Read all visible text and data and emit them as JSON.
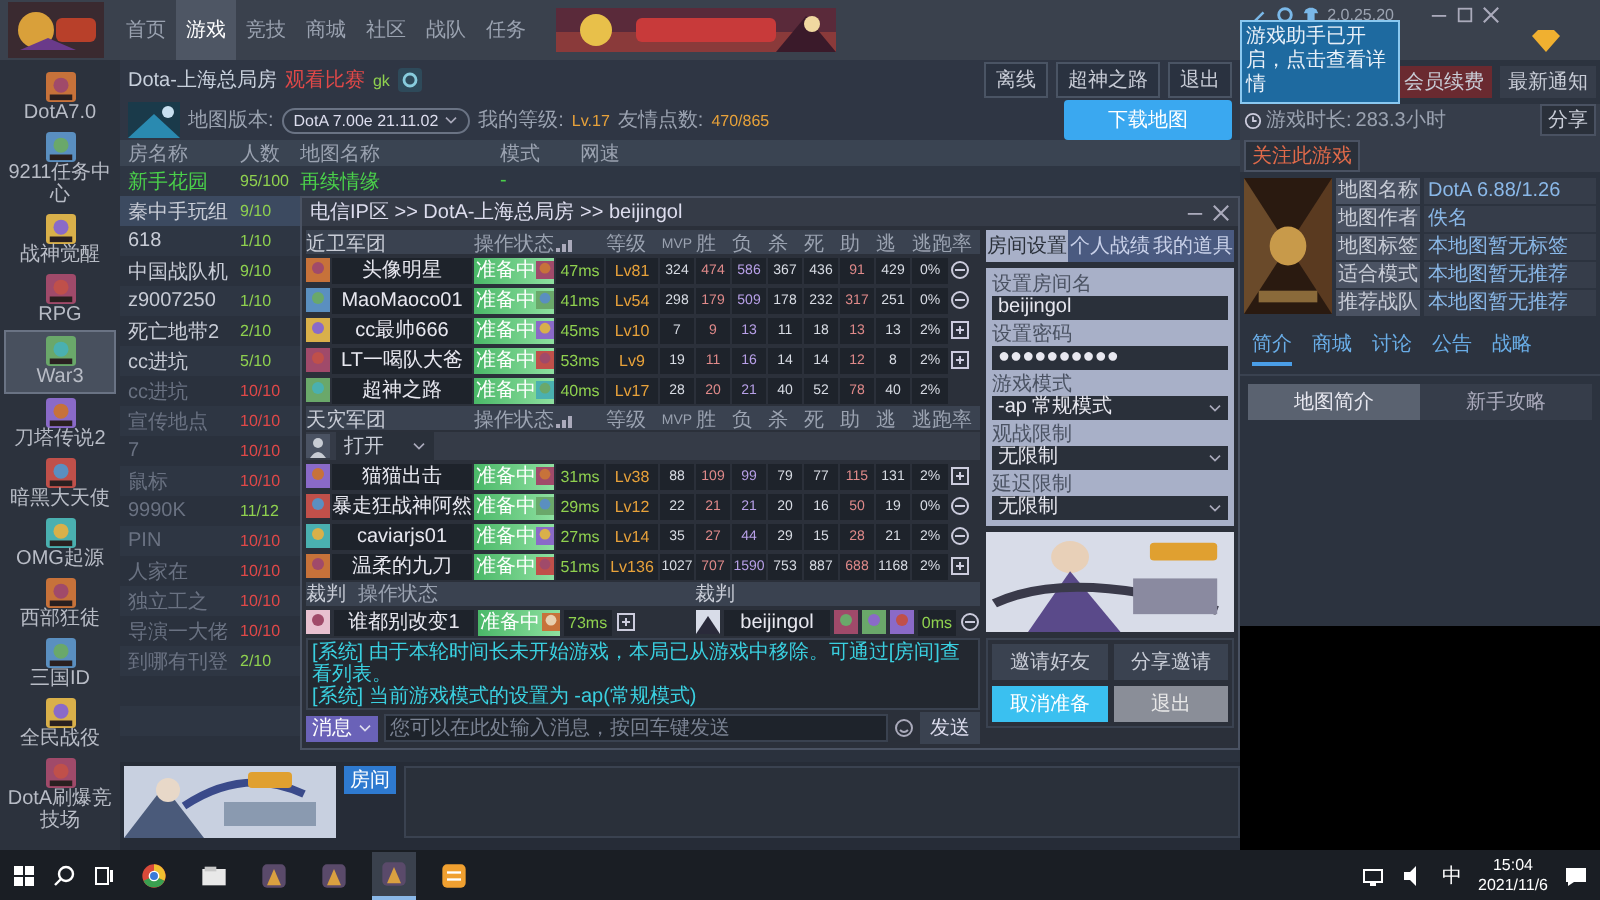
{
  "app_bar": {
    "tabs": [
      {
        "label": "首页",
        "selected": false
      },
      {
        "label": "游戏",
        "selected": true
      },
      {
        "label": "竞技",
        "selected": false
      },
      {
        "label": "商城",
        "selected": false
      },
      {
        "label": "社区",
        "selected": false
      },
      {
        "label": "战队",
        "selected": false
      },
      {
        "label": "任务",
        "selected": false
      }
    ],
    "version": "2.0.25.20"
  },
  "notice_popup": {
    "text": "游戏助手已开启，点击查看详情"
  },
  "sidebar": {
    "items": [
      {
        "label": "DotA7.0",
        "selected": false
      },
      {
        "label": "9211任务中心",
        "selected": false
      },
      {
        "label": "战神觉醒",
        "selected": false
      },
      {
        "label": "RPG",
        "selected": false
      },
      {
        "label": "War3",
        "selected": true
      },
      {
        "label": "刀塔传说2",
        "selected": false
      },
      {
        "label": "暗黑大天使",
        "selected": false
      },
      {
        "label": "OMG起源",
        "selected": false
      },
      {
        "label": "西部狂徒",
        "selected": false
      },
      {
        "label": "三国ID",
        "selected": false
      },
      {
        "label": "全民战役",
        "selected": false
      },
      {
        "label": "DotA刷爆竞技场",
        "selected": false
      }
    ]
  },
  "room": {
    "title": "Dota-上海总局房",
    "tag": "观看比赛",
    "code": "gk",
    "map_version_label": "地图版本:",
    "map_version": "DotA 7.00e 21.11.02",
    "level_label": "我的等级:",
    "level": "Lv.17",
    "friend_label": "友情点数:",
    "friend_points": "470/865",
    "actions": [
      "离线",
      "超神之路",
      "退出"
    ],
    "download": "下载地图"
  },
  "room_list": {
    "columns": [
      "房名称",
      "人数",
      "地图名称",
      "模式",
      "网速"
    ],
    "rows": [
      {
        "name": "新手花园",
        "players": "95/100",
        "map": "再续情缘",
        "mode": "-",
        "featured": true,
        "full": false,
        "in_game": false,
        "selected": false
      },
      {
        "name": "秦中手玩组",
        "players": "9/10",
        "featured": false,
        "full": false,
        "in_game": false,
        "selected": true
      },
      {
        "name": "618",
        "players": "1/10",
        "featured": false,
        "full": false,
        "in_game": false,
        "selected": false
      },
      {
        "name": "中国战队机",
        "players": "9/10",
        "featured": false,
        "full": false,
        "in_game": false,
        "selected": false
      },
      {
        "name": "z9007250",
        "players": "1/10",
        "featured": false,
        "full": false,
        "in_game": false,
        "selected": false
      },
      {
        "name": "死亡地带2",
        "players": "2/10",
        "featured": false,
        "full": false,
        "in_game": false,
        "selected": false
      },
      {
        "name": "cc进坑",
        "players": "5/10",
        "featured": false,
        "full": false,
        "in_game": false,
        "selected": false
      },
      {
        "name": "cc进坑",
        "players": "10/10",
        "featured": false,
        "full": true,
        "in_game": true,
        "selected": false
      },
      {
        "name": "宣传地点",
        "players": "10/10",
        "featured": false,
        "full": true,
        "in_game": true,
        "selected": false
      },
      {
        "name": "7",
        "players": "10/10",
        "featured": false,
        "full": true,
        "in_game": true,
        "selected": false
      },
      {
        "name": "鼠标",
        "players": "10/10",
        "featured": false,
        "full": true,
        "in_game": true,
        "selected": false
      },
      {
        "name": "9990K",
        "players": "11/12",
        "featured": false,
        "full": false,
        "in_game": true,
        "selected": false
      },
      {
        "name": "PIN",
        "players": "10/10",
        "featured": false,
        "full": true,
        "in_game": true,
        "selected": false
      },
      {
        "name": "人家在",
        "players": "10/10",
        "featured": false,
        "full": true,
        "in_game": true,
        "selected": false
      },
      {
        "name": "独立工之",
        "players": "10/10",
        "featured": false,
        "full": true,
        "in_game": true,
        "selected": false
      },
      {
        "name": "导演一大佬",
        "players": "10/10",
        "featured": false,
        "full": true,
        "in_game": true,
        "selected": false
      },
      {
        "name": "到哪有刊登",
        "players": "2/10",
        "featured": false,
        "full": false,
        "in_game": true,
        "selected": false
      }
    ]
  },
  "room_dialog": {
    "title": "电信IP区 >> DotA-上海总局房 >> beijingol",
    "teams": [
      {
        "name": "近卫军团",
        "status_column": "操作状态",
        "stat_columns": [
          "等级",
          "MVP",
          "胜",
          "负",
          "杀",
          "死",
          "助",
          "逃",
          "逃跑率"
        ],
        "players": [
          {
            "name": "头像明星",
            "status": "准备中",
            "ready": true,
            "ping": "47ms",
            "level": "Lv81",
            "stats": [
              "324",
              "474",
              "586",
              "367",
              "436",
              "91",
              "429"
            ],
            "rate": "0%",
            "kind": "kick"
          },
          {
            "name": "MaoMaoco01",
            "status": "准备中",
            "ready": true,
            "ping": "41ms",
            "level": "Lv54",
            "stats": [
              "298",
              "179",
              "509",
              "178",
              "232",
              "317",
              "251"
            ],
            "rate": "0%",
            "kind": "kick"
          },
          {
            "name": "cc最帅666",
            "status": "准备中",
            "ready": true,
            "ping": "45ms",
            "level": "Lv10",
            "stats": [
              "7",
              "9",
              "13",
              "11",
              "18",
              "13",
              "13"
            ],
            "rate": "2%",
            "kind": "add"
          },
          {
            "name": "LT一喝队大爸",
            "status": "准备中",
            "ready": true,
            "ping": "53ms",
            "level": "Lv9",
            "stats": [
              "19",
              "11",
              "16",
              "14",
              "14",
              "12",
              "8"
            ],
            "rate": "2%",
            "kind": "add"
          },
          {
            "name": "超神之路",
            "status": "准备中",
            "ready": true,
            "ping": "40ms",
            "level": "Lv17",
            "stats": [
              "28",
              "20",
              "21",
              "40",
              "52",
              "78",
              "40"
            ],
            "rate": "2%"
          }
        ]
      },
      {
        "name": "天灾军团",
        "status_column": "操作状态",
        "stat_columns": [
          "等级",
          "MVP",
          "胜",
          "负",
          "杀",
          "死",
          "助",
          "逃",
          "逃跑率"
        ],
        "filter": "打开",
        "players": [
          {
            "name": "猫猫出击",
            "status": "准备中",
            "ready": true,
            "ping": "31ms",
            "level": "Lv38",
            "stats": [
              "88",
              "109",
              "99",
              "79",
              "77",
              "115",
              "131"
            ],
            "rate": "2%",
            "kind": "add"
          },
          {
            "name": "暴走狂战神阿然",
            "status": "准备中",
            "ready": true,
            "ping": "29ms",
            "level": "Lv12",
            "stats": [
              "22",
              "21",
              "21",
              "20",
              "16",
              "50",
              "19"
            ],
            "rate": "0%",
            "kind": "kick"
          },
          {
            "name": "caviarjs01",
            "status": "准备中",
            "ready": true,
            "ping": "27ms",
            "level": "Lv14",
            "stats": [
              "35",
              "27",
              "44",
              "29",
              "15",
              "28",
              "21"
            ],
            "rate": "2%",
            "kind": "kick"
          },
          {
            "name": "温柔的九刀",
            "status": "准备中",
            "ready": true,
            "ping": "51ms",
            "level": "Lv136",
            "stats": [
              "1027",
              "707",
              "1590",
              "753",
              "887",
              "688",
              "1168"
            ],
            "rate": "2%",
            "kind": "add"
          }
        ]
      }
    ],
    "referee": {
      "label": "裁判",
      "status_column": "操作状态",
      "right_label": "裁判",
      "left": {
        "name": "谁都别改变1",
        "status": "准备中",
        "ready": true,
        "ping": "73ms",
        "kind": "add"
      },
      "right": {
        "name": "beijingol",
        "ping": "0ms",
        "kind": "kick"
      }
    },
    "messages": [
      {
        "kind": "system",
        "text": "[系统] 由于本轮时间长未开始游戏，本局已从游戏中移除。可通过[房间]查看列表。"
      },
      {
        "kind": "system",
        "text": "[系统] 当前游戏模式的设置为 -ap(常规模式)"
      }
    ],
    "chat_channel": "消息",
    "chat_placeholder": "您可以在此处输入消息，按回车键发送",
    "send": "发送",
    "settings_tabs": [
      {
        "label": "房间设置",
        "selected": true
      },
      {
        "label": "个人战绩",
        "selected": false
      },
      {
        "label": "我的道具",
        "selected": false
      }
    ],
    "settings": [
      {
        "label": "设置房间名",
        "value": "beijingol",
        "kind": "text"
      },
      {
        "label": "设置密码",
        "value": "●●●●●●●●●●",
        "kind": "text"
      },
      {
        "label": "游戏模式",
        "value": "-ap 常规模式",
        "kind": "select"
      },
      {
        "label": "观战限制",
        "value": "无限制",
        "kind": "select"
      },
      {
        "label": "延迟限制",
        "value": "无限制",
        "kind": "select"
      }
    ],
    "buttons": [
      {
        "label": "邀请好友",
        "kind": "plain"
      },
      {
        "label": "分享邀请",
        "kind": "plain"
      },
      {
        "label": "取消准备",
        "kind": "primary"
      },
      {
        "label": "退出",
        "kind": "muted"
      }
    ]
  },
  "bottom": {
    "tag": "房间"
  },
  "right_panel": {
    "buttons": [
      "会员续费",
      "最新通知"
    ],
    "play_time_label": "游戏时长:",
    "play_time": "283.3小时",
    "share": "分享",
    "follow": "关注此游戏",
    "info": [
      {
        "label": "地图名称",
        "value": "DotA 6.88/1.26"
      },
      {
        "label": "地图作者",
        "value": "佚名"
      },
      {
        "label": "地图标签",
        "value": "本地图暂无标签"
      },
      {
        "label": "适合模式",
        "value": "本地图暂无推荐"
      },
      {
        "label": "推荐战队",
        "value": "本地图暂无推荐"
      }
    ],
    "tabs": [
      {
        "label": "简介",
        "selected": true
      },
      {
        "label": "商城",
        "selected": false
      },
      {
        "label": "讨论",
        "selected": false
      },
      {
        "label": "公告",
        "selected": false
      },
      {
        "label": "战略",
        "selected": false
      }
    ],
    "subtabs": [
      {
        "label": "地图简介",
        "selected": true
      },
      {
        "label": "新手攻略",
        "selected": false
      }
    ]
  },
  "taskbar": {
    "apps": [
      {
        "kind": "browser",
        "active": false
      },
      {
        "kind": "files",
        "active": false
      },
      {
        "kind": "game",
        "active": false
      },
      {
        "kind": "game",
        "active": false
      },
      {
        "kind": "game",
        "active": true
      },
      {
        "kind": "notes",
        "active": false
      }
    ],
    "ime": "中",
    "time": "15:04",
    "date": "2021/11/6"
  }
}
